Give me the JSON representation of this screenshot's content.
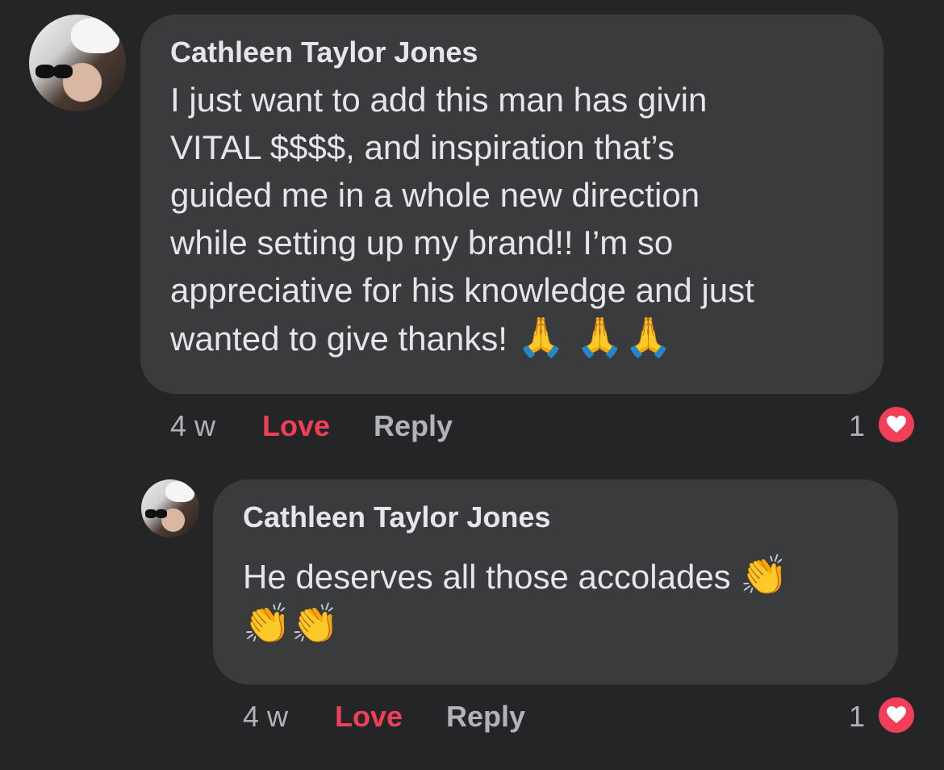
{
  "comment": {
    "author": "Cathleen Taylor Jones",
    "lines": [
      "I just want to add this man has givin",
      "VITAL $$$$, and inspiration that’s",
      "guided me in a whole new direction",
      "while setting up my brand!! I’m so",
      "appreciative for his knowledge and just",
      "wanted to give thanks!"
    ],
    "emoji": "🙏 🙏🙏",
    "time": "4 w",
    "love_label": "Love",
    "reply_label": "Reply",
    "reaction_count": "1",
    "reaction_icon": "heart-icon"
  },
  "reply": {
    "author": "Cathleen Taylor Jones",
    "lines": [
      "He deserves all those accolades"
    ],
    "emoji_inline": "👏",
    "emoji_line": "👏👏",
    "time": "4 w",
    "love_label": "Love",
    "reply_label": "Reply",
    "reaction_count": "1",
    "reaction_icon": "heart-icon"
  },
  "colors": {
    "background": "#242526",
    "bubble": "#3a3b3c",
    "text": "#e4e6eb",
    "muted": "#b0b3b8",
    "love": "#f33e58"
  }
}
